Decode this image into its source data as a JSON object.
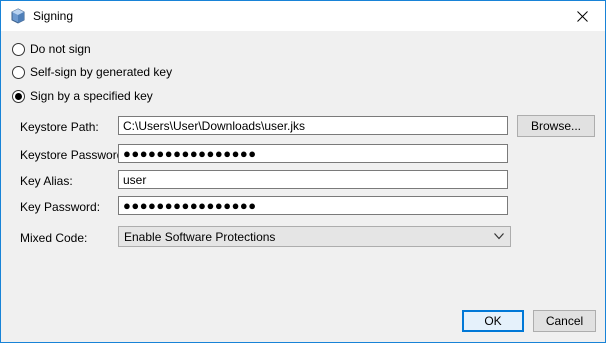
{
  "window": {
    "title": "Signing"
  },
  "options": [
    {
      "label": "Do not sign",
      "checked": false
    },
    {
      "label": "Self-sign by generated key",
      "checked": false
    },
    {
      "label": "Sign by a specified key",
      "checked": true
    }
  ],
  "fields": {
    "keystore_path": {
      "label": "Keystore Path:",
      "value": "C:\\Users\\User\\Downloads\\user.jks"
    },
    "keystore_password": {
      "label": "Keystore Password:",
      "value": "●●●●●●●●●●●●●●●●"
    },
    "key_alias": {
      "label": "Key Alias:",
      "value": "user"
    },
    "key_password": {
      "label": "Key Password:",
      "value": "●●●●●●●●●●●●●●●●"
    },
    "mixed_code": {
      "label": "Mixed Code:",
      "value": "Enable Software Protections"
    }
  },
  "buttons": {
    "browse": "Browse...",
    "ok": "OK",
    "cancel": "Cancel"
  },
  "colors": {
    "accent": "#0078d7",
    "window_border": "#1883d7",
    "background": "#f0f0f0"
  }
}
